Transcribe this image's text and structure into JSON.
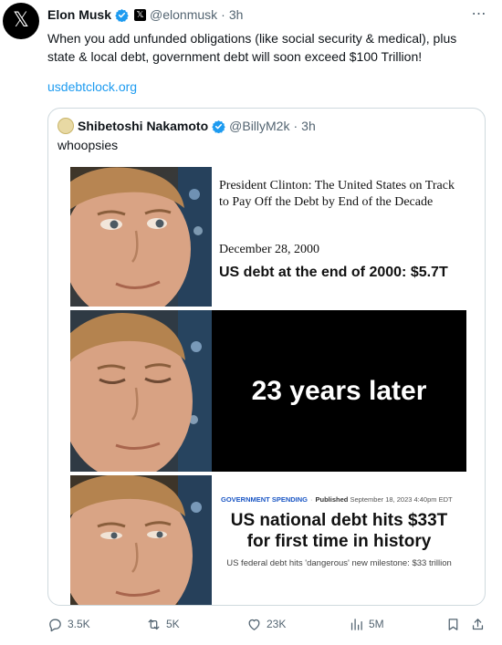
{
  "tweet": {
    "author_name": "Elon Musk",
    "handle": "@elonmusk",
    "separator": "·",
    "time": "3h",
    "text": "When you add unfunded obligations (like social security & medical), plus state & local debt, government debt will soon exceed $100 Trillion!",
    "link": "usdebtclock.org",
    "more_icon": "⋯"
  },
  "quote": {
    "author_name": "Shibetoshi Nakamoto",
    "handle": "@BillyM2k",
    "separator": "·",
    "time": "3h",
    "text": "whoopsies"
  },
  "meme": {
    "panel1": {
      "headline": "President Clinton: The United States on Track to Pay Off the Debt by End of the Decade",
      "date": "December 28, 2000",
      "debt": "US debt at the end of 2000: $5.7T"
    },
    "panel2": {
      "text": "23 years later"
    },
    "panel3": {
      "section": "GOVERNMENT SPENDING",
      "sep": "·",
      "published_label": "Published",
      "published_date": "September 18, 2023 4:40pm EDT",
      "title": "US national debt hits $33T for first time in history",
      "subtitle": "US federal debt hits 'dangerous' new milestone: $33 trillion"
    }
  },
  "actions": {
    "replies": "3.5K",
    "reposts": "5K",
    "likes": "23K",
    "views": "5M"
  },
  "colors": {
    "link": "#1d9bf0",
    "muted": "#536471",
    "verified": "#1d9bf0",
    "border": "#cfd9de"
  },
  "icons": [
    "x-logo-icon",
    "verified-badge-icon",
    "x-affiliate-icon",
    "more-icon",
    "reply-icon",
    "repost-icon",
    "like-icon",
    "views-icon",
    "bookmark-icon",
    "share-icon"
  ]
}
